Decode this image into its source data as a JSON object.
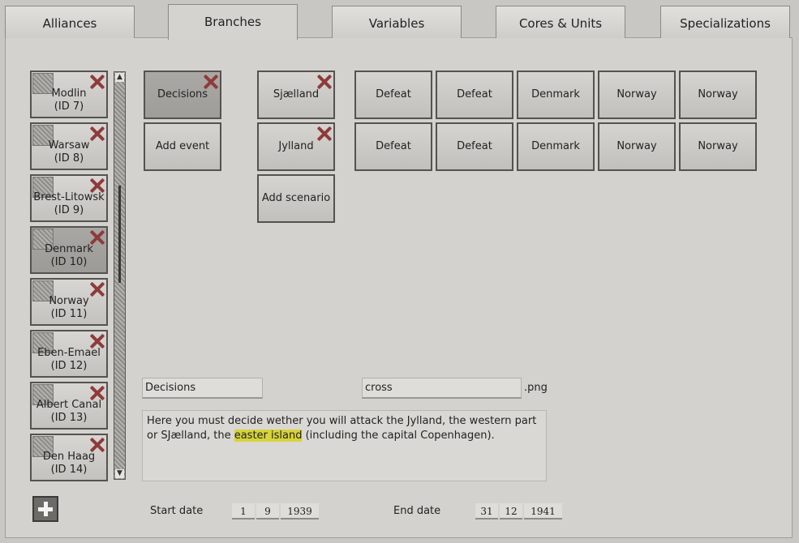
{
  "tabs": [
    "Alliances",
    "Branches",
    "Variables",
    "Cores & Units",
    "Specializations"
  ],
  "provinces": [
    {
      "name": "Modlin",
      "id": "(ID 7)"
    },
    {
      "name": "Warsaw",
      "id": "(ID 8)"
    },
    {
      "name": "Brest-Litowsk",
      "id": "(ID 9)"
    },
    {
      "name": "Denmark",
      "id": "(ID 10)"
    },
    {
      "name": "Norway",
      "id": "(ID 11)"
    },
    {
      "name": "Eben-Emael",
      "id": "(ID 12)"
    },
    {
      "name": "Albert Canal",
      "id": "(ID 13)"
    },
    {
      "name": "Den Haag",
      "id": "(ID 14)"
    }
  ],
  "branches": {
    "decisions": "Decisions",
    "add_event": "Add event"
  },
  "scenarios": {
    "sjaelland": "Sjælland",
    "jylland": "Jylland",
    "add_scenario": "Add scenario"
  },
  "outcomes": {
    "row1": [
      "Defeat",
      "Defeat",
      "Denmark",
      "Norway",
      "Norway"
    ],
    "row2": [
      "Defeat",
      "Defeat",
      "Denmark",
      "Norway",
      "Norway"
    ]
  },
  "editor": {
    "title_value": "Decisions",
    "image_value": "cross",
    "image_ext": ".png",
    "desc_pre": "Here you must decide wether you will attack the Jylland, the western part or SJælland, the ",
    "desc_highlight": "easter island",
    "desc_post": " (including the capital Copenhagen)."
  },
  "dates": {
    "start_label": "Start date",
    "start_day": "1",
    "start_month": "9",
    "start_year": "1939",
    "end_label": "End date",
    "end_day": "31",
    "end_month": "12",
    "end_year": "1941"
  },
  "colors": {
    "background": "#c9c7c4",
    "highlight": "#d7d33a",
    "delete_x": "#8e3b3b"
  }
}
